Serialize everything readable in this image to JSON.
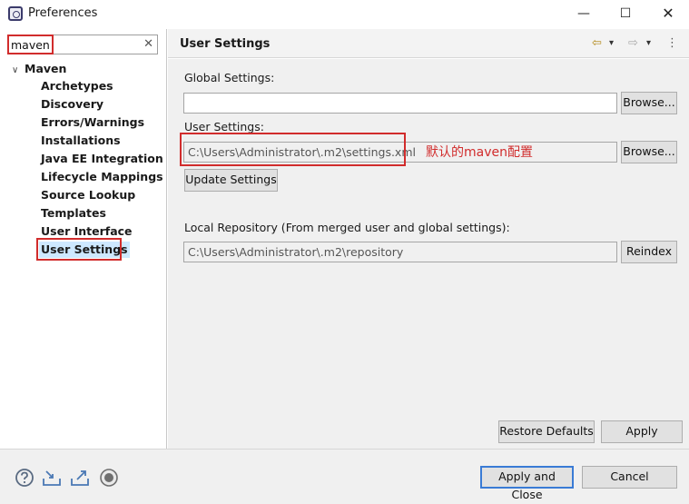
{
  "window": {
    "title": "Preferences",
    "minimize_glyph": "—",
    "maximize_glyph": "☐",
    "close_glyph": "✕"
  },
  "sidebar": {
    "filter_value": "maven",
    "clear_glyph": "✕",
    "root": {
      "caret": "∨",
      "label": "Maven"
    },
    "items": [
      {
        "label": "Archetypes"
      },
      {
        "label": "Discovery"
      },
      {
        "label": "Errors/Warnings"
      },
      {
        "label": "Installations"
      },
      {
        "label": "Java EE Integration"
      },
      {
        "label": "Lifecycle Mappings"
      },
      {
        "label": "Source Lookup"
      },
      {
        "label": "Templates"
      },
      {
        "label": "User Interface"
      },
      {
        "label": "User Settings",
        "selected": true
      }
    ]
  },
  "page": {
    "title": "User Settings",
    "nav": {
      "back": "⇦",
      "back_menu": "▾",
      "forward": "⇨",
      "forward_menu": "▾",
      "more": "⋮"
    },
    "global_settings_label": "Global Settings:",
    "global_settings_value": "",
    "browse_label": "Browse...",
    "user_settings_label": "User Settings:",
    "user_settings_value": "C:\\Users\\Administrator\\.m2\\settings.xml",
    "annotation": "默认的maven配置",
    "update_settings_label": "Update Settings",
    "local_repo_label": "Local Repository (From merged user and global settings):",
    "local_repo_value": "C:\\Users\\Administrator\\.m2\\repository",
    "reindex_label": "Reindex",
    "restore_defaults_label": "Restore Defaults",
    "apply_label": "Apply"
  },
  "footer": {
    "apply_close_label": "Apply and Close",
    "cancel_label": "Cancel",
    "icons": [
      "help-icon",
      "import-icon",
      "export-icon",
      "record-icon"
    ]
  },
  "colors": {
    "highlight": "#d12c2c",
    "selection": "#cde8ff",
    "default_button_border": "#3a7bd5"
  }
}
